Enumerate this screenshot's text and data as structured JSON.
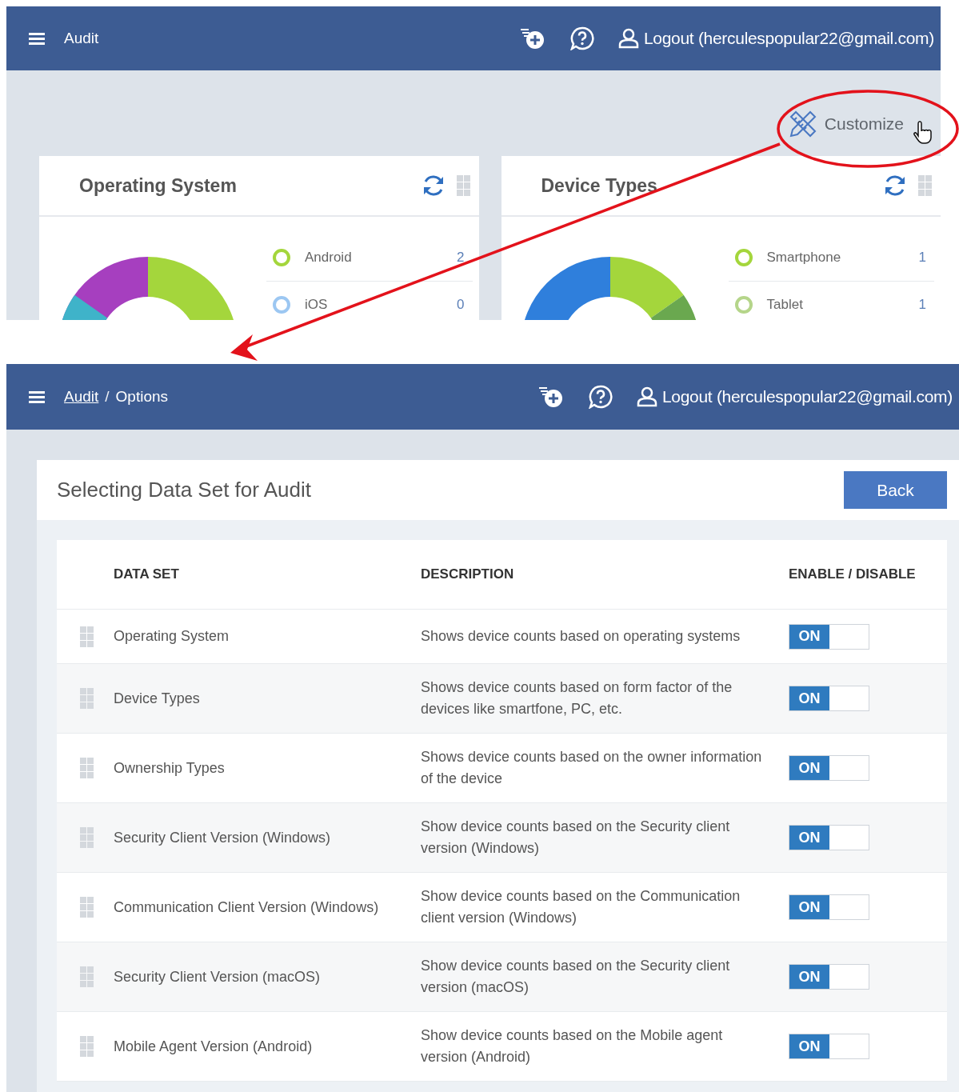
{
  "top_screen": {
    "header": {
      "title": "Audit",
      "logout": "Logout (herculespopular22@gmail.com)"
    },
    "customize": "Customize",
    "widgets": [
      {
        "title": "Operating System",
        "legend": [
          {
            "label": "Android",
            "count": "2",
            "color": "#a4d63c"
          },
          {
            "label": "iOS",
            "count": "0",
            "color": "#9cc7f2"
          }
        ]
      },
      {
        "title": "Device Types",
        "legend": [
          {
            "label": "Smartphone",
            "count": "1",
            "color": "#a4d63c"
          },
          {
            "label": "Tablet",
            "count": "1",
            "color": "#b5d58a"
          }
        ]
      }
    ]
  },
  "bottom_screen": {
    "header": {
      "breadcrumb": [
        {
          "label": "Audit",
          "kind": "link"
        },
        {
          "label": "Options",
          "kind": "current"
        }
      ],
      "separator": "/",
      "logout": "Logout (herculespopular22@gmail.com)"
    },
    "panel": {
      "title": "Selecting Data Set for Audit",
      "back": "Back"
    },
    "table": {
      "columns": [
        "DATA SET",
        "DESCRIPTION",
        "ENABLE / DISABLE"
      ],
      "rows": [
        {
          "data_set": "Operating System",
          "description": "Shows device counts based on operating systems",
          "toggle": "ON",
          "on": true
        },
        {
          "data_set": "Device Types",
          "description": "Shows device counts based on form factor of the devices like smartfone, PC, etc.",
          "toggle": "ON",
          "on": true
        },
        {
          "data_set": "Ownership Types",
          "description": "Shows device counts based on the owner information of the device",
          "toggle": "ON",
          "on": true
        },
        {
          "data_set": "Security Client Version (Windows)",
          "description": "Show device counts based on the Security client version (Windows)",
          "toggle": "ON",
          "on": true
        },
        {
          "data_set": "Communication Client Version (Windows)",
          "description": "Show device counts based on the Communication client version (Windows)",
          "toggle": "ON",
          "on": true
        },
        {
          "data_set": "Security Client Version (macOS)",
          "description": "Show device counts based on the Security client version (macOS)",
          "toggle": "ON",
          "on": true
        },
        {
          "data_set": "Mobile Agent Version (Android)",
          "description": "Show device counts based on the Mobile agent version (Android)",
          "toggle": "ON",
          "on": true
        }
      ]
    }
  }
}
